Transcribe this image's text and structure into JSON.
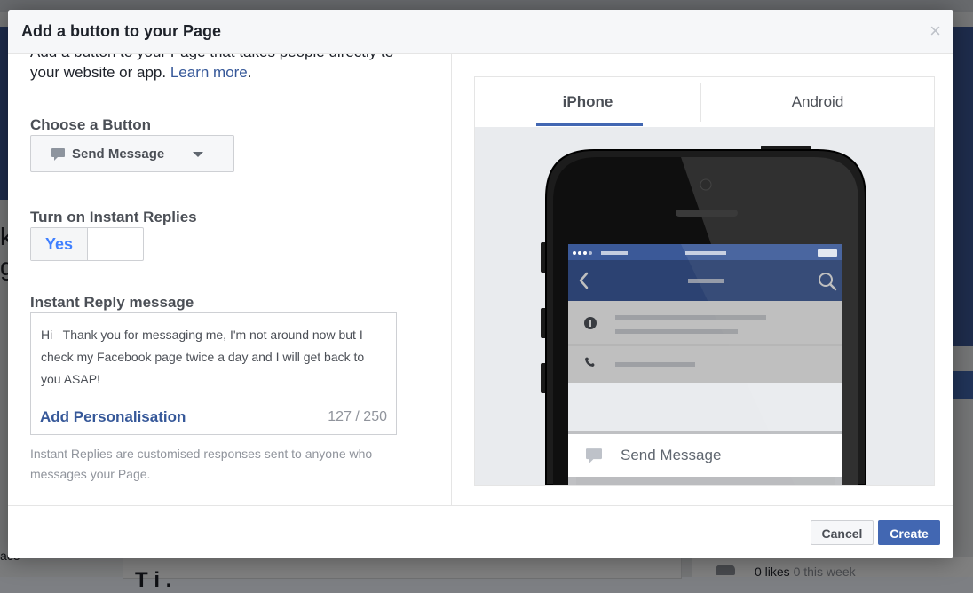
{
  "background_page": {
    "left_fragment": "k\ng",
    "bottom_left_fragment": "ace",
    "likes_count": "0 likes",
    "likes_week": "0 this week",
    "section_fragment": "T i   ."
  },
  "dialog": {
    "title": "Add a button to your Page",
    "close_glyph": "×",
    "intro_text": "Add a button to your Page that takes people directly to your website or app.",
    "intro_link": "Learn more",
    "choose_button_label": "Choose a Button",
    "selected_button": "Send Message",
    "instant_replies_label": "Turn on Instant Replies",
    "toggle_value": "Yes",
    "reply_message_label": "Instant Reply message",
    "reply_message": "Hi   Thank you for messaging me, I'm not around now but I check my Facebook page twice a day and I will get back to you ASAP!",
    "add_personalisation": "Add Personalisation",
    "char_count": "127 / 250",
    "help_text": "Instant Replies are customised responses sent to anyone who messages your Page.",
    "cancel_label": "Cancel",
    "create_label": "Create"
  },
  "preview": {
    "tabs": [
      {
        "label": "iPhone",
        "active": true
      },
      {
        "label": "Android",
        "active": false
      }
    ],
    "send_message_label": "Send Message"
  },
  "icons": {
    "close": "close-icon",
    "message": "message-bubble-icon",
    "dropdown": "chevron-down-icon",
    "info": "info-icon",
    "phone": "phone-icon",
    "search": "search-icon",
    "back": "back-chevron-icon"
  },
  "colors": {
    "brand_blue": "#4267b2",
    "link_blue": "#365899",
    "toggle_blue": "#4080ff",
    "header_bg": "#f6f7f9"
  }
}
